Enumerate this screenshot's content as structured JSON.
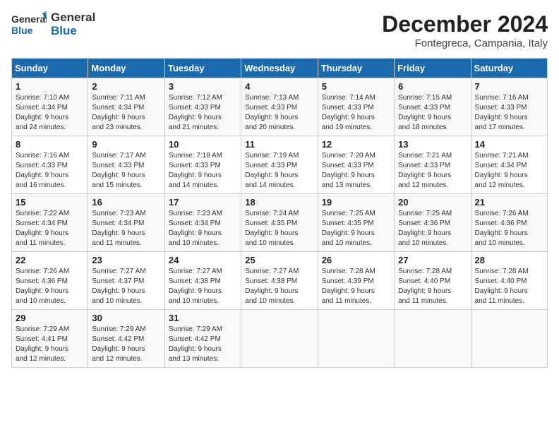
{
  "header": {
    "logo_general": "General",
    "logo_blue": "Blue",
    "month": "December 2024",
    "location": "Fontegreca, Campania, Italy"
  },
  "days_of_week": [
    "Sunday",
    "Monday",
    "Tuesday",
    "Wednesday",
    "Thursday",
    "Friday",
    "Saturday"
  ],
  "weeks": [
    [
      {
        "day": "1",
        "info": "Sunrise: 7:10 AM\nSunset: 4:34 PM\nDaylight: 9 hours\nand 24 minutes."
      },
      {
        "day": "2",
        "info": "Sunrise: 7:11 AM\nSunset: 4:34 PM\nDaylight: 9 hours\nand 23 minutes."
      },
      {
        "day": "3",
        "info": "Sunrise: 7:12 AM\nSunset: 4:33 PM\nDaylight: 9 hours\nand 21 minutes."
      },
      {
        "day": "4",
        "info": "Sunrise: 7:13 AM\nSunset: 4:33 PM\nDaylight: 9 hours\nand 20 minutes."
      },
      {
        "day": "5",
        "info": "Sunrise: 7:14 AM\nSunset: 4:33 PM\nDaylight: 9 hours\nand 19 minutes."
      },
      {
        "day": "6",
        "info": "Sunrise: 7:15 AM\nSunset: 4:33 PM\nDaylight: 9 hours\nand 18 minutes."
      },
      {
        "day": "7",
        "info": "Sunrise: 7:16 AM\nSunset: 4:33 PM\nDaylight: 9 hours\nand 17 minutes."
      }
    ],
    [
      {
        "day": "8",
        "info": "Sunrise: 7:16 AM\nSunset: 4:33 PM\nDaylight: 9 hours\nand 16 minutes."
      },
      {
        "day": "9",
        "info": "Sunrise: 7:17 AM\nSunset: 4:33 PM\nDaylight: 9 hours\nand 15 minutes."
      },
      {
        "day": "10",
        "info": "Sunrise: 7:18 AM\nSunset: 4:33 PM\nDaylight: 9 hours\nand 14 minutes."
      },
      {
        "day": "11",
        "info": "Sunrise: 7:19 AM\nSunset: 4:33 PM\nDaylight: 9 hours\nand 14 minutes."
      },
      {
        "day": "12",
        "info": "Sunrise: 7:20 AM\nSunset: 4:33 PM\nDaylight: 9 hours\nand 13 minutes."
      },
      {
        "day": "13",
        "info": "Sunrise: 7:21 AM\nSunset: 4:33 PM\nDaylight: 9 hours\nand 12 minutes."
      },
      {
        "day": "14",
        "info": "Sunrise: 7:21 AM\nSunset: 4:34 PM\nDaylight: 9 hours\nand 12 minutes."
      }
    ],
    [
      {
        "day": "15",
        "info": "Sunrise: 7:22 AM\nSunset: 4:34 PM\nDaylight: 9 hours\nand 11 minutes."
      },
      {
        "day": "16",
        "info": "Sunrise: 7:23 AM\nSunset: 4:34 PM\nDaylight: 9 hours\nand 11 minutes."
      },
      {
        "day": "17",
        "info": "Sunrise: 7:23 AM\nSunset: 4:34 PM\nDaylight: 9 hours\nand 10 minutes."
      },
      {
        "day": "18",
        "info": "Sunrise: 7:24 AM\nSunset: 4:35 PM\nDaylight: 9 hours\nand 10 minutes."
      },
      {
        "day": "19",
        "info": "Sunrise: 7:25 AM\nSunset: 4:35 PM\nDaylight: 9 hours\nand 10 minutes."
      },
      {
        "day": "20",
        "info": "Sunrise: 7:25 AM\nSunset: 4:36 PM\nDaylight: 9 hours\nand 10 minutes."
      },
      {
        "day": "21",
        "info": "Sunrise: 7:26 AM\nSunset: 4:36 PM\nDaylight: 9 hours\nand 10 minutes."
      }
    ],
    [
      {
        "day": "22",
        "info": "Sunrise: 7:26 AM\nSunset: 4:36 PM\nDaylight: 9 hours\nand 10 minutes."
      },
      {
        "day": "23",
        "info": "Sunrise: 7:27 AM\nSunset: 4:37 PM\nDaylight: 9 hours\nand 10 minutes."
      },
      {
        "day": "24",
        "info": "Sunrise: 7:27 AM\nSunset: 4:38 PM\nDaylight: 9 hours\nand 10 minutes."
      },
      {
        "day": "25",
        "info": "Sunrise: 7:27 AM\nSunset: 4:38 PM\nDaylight: 9 hours\nand 10 minutes."
      },
      {
        "day": "26",
        "info": "Sunrise: 7:28 AM\nSunset: 4:39 PM\nDaylight: 9 hours\nand 11 minutes."
      },
      {
        "day": "27",
        "info": "Sunrise: 7:28 AM\nSunset: 4:40 PM\nDaylight: 9 hours\nand 11 minutes."
      },
      {
        "day": "28",
        "info": "Sunrise: 7:28 AM\nSunset: 4:40 PM\nDaylight: 9 hours\nand 11 minutes."
      }
    ],
    [
      {
        "day": "29",
        "info": "Sunrise: 7:29 AM\nSunset: 4:41 PM\nDaylight: 9 hours\nand 12 minutes."
      },
      {
        "day": "30",
        "info": "Sunrise: 7:29 AM\nSunset: 4:42 PM\nDaylight: 9 hours\nand 12 minutes."
      },
      {
        "day": "31",
        "info": "Sunrise: 7:29 AM\nSunset: 4:42 PM\nDaylight: 9 hours\nand 13 minutes."
      },
      {
        "day": "",
        "info": ""
      },
      {
        "day": "",
        "info": ""
      },
      {
        "day": "",
        "info": ""
      },
      {
        "day": "",
        "info": ""
      }
    ]
  ]
}
